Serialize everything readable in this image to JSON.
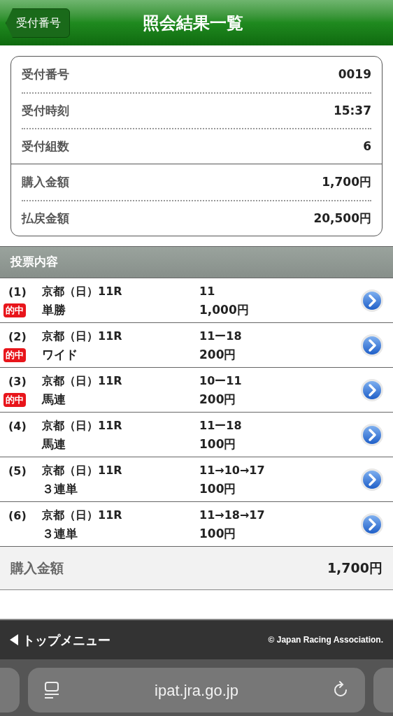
{
  "header": {
    "back_button": "受付番号",
    "title": "照会結果一覧"
  },
  "summary": {
    "groups": [
      [
        {
          "label": "受付番号",
          "value": "0019"
        },
        {
          "label": "受付時刻",
          "value": "15:37"
        },
        {
          "label": "受付組数",
          "value": "6"
        }
      ],
      [
        {
          "label": "購入金額",
          "value": "1,700円"
        },
        {
          "label": "払戻金額",
          "value": "20,500円"
        }
      ]
    ]
  },
  "section_title": "投票内容",
  "bets": [
    {
      "number": "(1)",
      "race": "京都（日）11R",
      "badge": "的中",
      "type": "単勝",
      "combination": "11",
      "amount": "1,000円"
    },
    {
      "number": "(2)",
      "race": "京都（日）11R",
      "badge": "的中",
      "type": "ワイド",
      "combination": "11ー18",
      "amount": "200円"
    },
    {
      "number": "(3)",
      "race": "京都（日）11R",
      "badge": "的中",
      "type": "馬連",
      "combination": "10ー11",
      "amount": "200円"
    },
    {
      "number": "(4)",
      "race": "京都（日）11R",
      "type": "馬連",
      "combination": "11ー18",
      "amount": "100円"
    },
    {
      "number": "(5)",
      "race": "京都（日）11R",
      "type": "３連単",
      "combination": "11→10→17",
      "amount": "100円"
    },
    {
      "number": "(6)",
      "race": "京都（日）11R",
      "type": "３連単",
      "combination": "11→18→17",
      "amount": "100円"
    }
  ],
  "total": {
    "label": "購入金額",
    "value": "1,700円"
  },
  "footer": {
    "menu_link": "トップメニュー",
    "copyright": "© Japan Racing Association."
  },
  "browser": {
    "url": "ipat.jra.go.jp"
  }
}
